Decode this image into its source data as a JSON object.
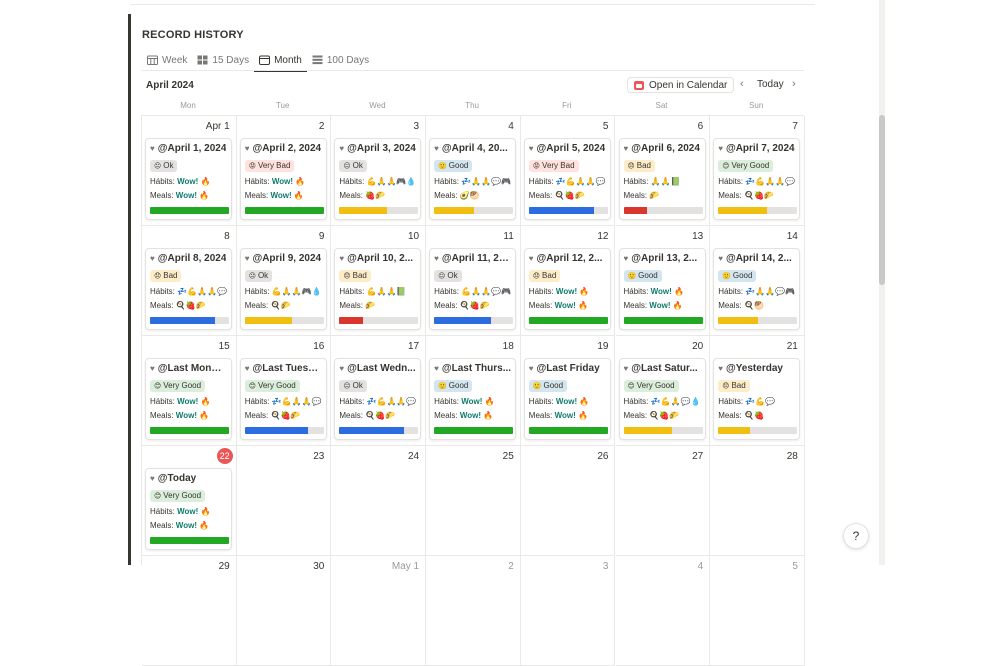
{
  "section_title": "RECORD HISTORY",
  "tabs": [
    {
      "label": "Week",
      "icon": "calendar-week-icon"
    },
    {
      "label": "15 Days",
      "icon": "grid-icon"
    },
    {
      "label": "Month",
      "icon": "calendar-month-icon",
      "active": true
    },
    {
      "label": "100 Days",
      "icon": "table-icon"
    }
  ],
  "calendar": {
    "month_label": "April 2024",
    "open_in_calendar": "Open in Calendar",
    "today_label": "Today",
    "prev_icon": "chevron-left-icon",
    "next_icon": "chevron-right-icon",
    "weekdays": [
      "Mon",
      "Tue",
      "Wed",
      "Thu",
      "Fri",
      "Sat",
      "Sun"
    ],
    "colors": {
      "green": "#22a822",
      "yellow": "#f1bf12",
      "red": "#d9362e",
      "blue": "#2b6ce0"
    },
    "weeks": [
      [
        {
          "day": "Apr 1",
          "title": "@April 1, 2024",
          "mood": "Ok",
          "habits": "Wow! 🔥",
          "meals": "Wow! 🔥",
          "bar": "green",
          "fill": 1.0
        },
        {
          "day": "2",
          "title": "@April 2, 2024",
          "mood": "Very Bad",
          "habits": "Wow! 🔥",
          "meals": "Wow! 🔥",
          "bar": "green",
          "fill": 1.0
        },
        {
          "day": "3",
          "title": "@April 3, 2024",
          "mood": "Ok",
          "habits": "💪🙏🙏🎮💧📗",
          "meals": "🍓🌮",
          "bar": "yellow",
          "fill": 0.6
        },
        {
          "day": "4",
          "title": "@April 4, 20...",
          "mood": "Good",
          "habits": "💤🙏🙏💬🎮",
          "meals": "🥑🥙",
          "bar": "yellow",
          "fill": 0.5
        },
        {
          "day": "5",
          "title": "@April 5, 2024",
          "mood": "Very Bad",
          "habits": "💤💪🙏🙏💬💧📘",
          "meals": "🍳🍓🌮",
          "bar": "blue",
          "fill": 0.82
        },
        {
          "day": "6",
          "title": "@April 6, 2024",
          "mood": "Bad",
          "habits": "🙏🙏📗",
          "meals": "🌮",
          "bar": "red",
          "fill": 0.3
        },
        {
          "day": "7",
          "title": "@April 7, 2024",
          "mood": "Very Good",
          "habits": "💤💪🙏🙏💬💧",
          "meals": "🍳🍓🌮",
          "bar": "yellow",
          "fill": 0.62
        }
      ],
      [
        {
          "day": "8",
          "title": "@April 8, 2024",
          "mood": "Bad",
          "habits": "💤💪🙏🙏💬💧📘",
          "meals": "🍳🍓🌮",
          "bar": "blue",
          "fill": 0.82
        },
        {
          "day": "9",
          "title": "@April 9, 2024",
          "mood": "Ok",
          "habits": "💪🙏🙏🎮💧📗",
          "meals": "🍳🌮",
          "bar": "yellow",
          "fill": 0.6
        },
        {
          "day": "10",
          "title": "@April 10, 2...",
          "mood": "Bad",
          "habits": "💪🙏🙏📗",
          "meals": "🌮",
          "bar": "red",
          "fill": 0.3
        },
        {
          "day": "11",
          "title": "@April 11, 20...",
          "mood": "Ok",
          "habits": "💪🙏🙏💬🎮💧📘",
          "meals": "🍳🍓🌮",
          "bar": "blue",
          "fill": 0.72
        },
        {
          "day": "12",
          "title": "@April 12, 2...",
          "mood": "Bad",
          "habits": "Wow! 🔥",
          "meals": "Wow! 🔥",
          "bar": "green",
          "fill": 1.0
        },
        {
          "day": "13",
          "title": "@April 13, 2...",
          "mood": "Good",
          "habits": "Wow! 🔥",
          "meals": "Wow! 🔥",
          "bar": "green",
          "fill": 1.0
        },
        {
          "day": "14",
          "title": "@April 14, 2...",
          "mood": "Good",
          "habits": "💤🙏🙏💬🎮",
          "meals": "🍳🥙",
          "bar": "yellow",
          "fill": 0.5
        }
      ],
      [
        {
          "day": "15",
          "title": "@Last Monday",
          "mood": "Very Good",
          "habits": "Wow! 🔥",
          "meals": "Wow! 🔥",
          "bar": "green",
          "fill": 1.0
        },
        {
          "day": "16",
          "title": "@Last Tuesd...",
          "mood": "Very Good",
          "habits": "💤💪🙏🙏💬💧📘",
          "meals": "🍳🍓🌮",
          "bar": "blue",
          "fill": 0.8
        },
        {
          "day": "17",
          "title": "@Last Wedn...",
          "mood": "Ok",
          "habits": "💤💪🙏🙏💬💧📘",
          "meals": "🍳🍓🌮",
          "bar": "blue",
          "fill": 0.82
        },
        {
          "day": "18",
          "title": "@Last Thurs...",
          "mood": "Good",
          "habits": "Wow! 🔥",
          "meals": "Wow! 🔥",
          "bar": "green",
          "fill": 1.0
        },
        {
          "day": "19",
          "title": "@Last Friday",
          "mood": "Good",
          "habits": "Wow! 🔥",
          "meals": "Wow! 🔥",
          "bar": "green",
          "fill": 1.0
        },
        {
          "day": "20",
          "title": "@Last Satur...",
          "mood": "Very Good",
          "habits": "💤💪🙏💬💧",
          "meals": "🍳🍓🌮",
          "bar": "yellow",
          "fill": 0.62
        },
        {
          "day": "21",
          "title": "@Yesterday",
          "mood": "Bad",
          "habits": "💤💪💬",
          "meals": "🍳🍓",
          "bar": "yellow",
          "fill": 0.4
        }
      ],
      [
        {
          "day": "22",
          "title": "@Today",
          "mood": "Very Good",
          "habits": "Wow! 🔥",
          "meals": "Wow! 🔥",
          "bar": "green",
          "fill": 1.0,
          "is_today": true
        },
        {
          "day": "23"
        },
        {
          "day": "24"
        },
        {
          "day": "25"
        },
        {
          "day": "26"
        },
        {
          "day": "27"
        },
        {
          "day": "28"
        }
      ],
      [
        {
          "day": "29"
        },
        {
          "day": "30"
        },
        {
          "day": "May 1",
          "faded": true
        },
        {
          "day": "2",
          "faded": true
        },
        {
          "day": "3",
          "faded": true
        },
        {
          "day": "4",
          "faded": true
        },
        {
          "day": "5",
          "faded": true
        }
      ]
    ]
  },
  "labels": {
    "habits": "Hábits:",
    "meals": "Meals:"
  },
  "moods": {
    "Very Good": {
      "bg": "#dbeddb",
      "face": "😊"
    },
    "Good": {
      "bg": "#d3e5ef",
      "face": "🙂"
    },
    "Ok": {
      "bg": "#e3e2e0",
      "face": "😐"
    },
    "Bad": {
      "bg": "#fdecc8",
      "face": "😞"
    },
    "Very Bad": {
      "bg": "#ffe2dd",
      "face": "😡"
    }
  },
  "help_label": "?"
}
